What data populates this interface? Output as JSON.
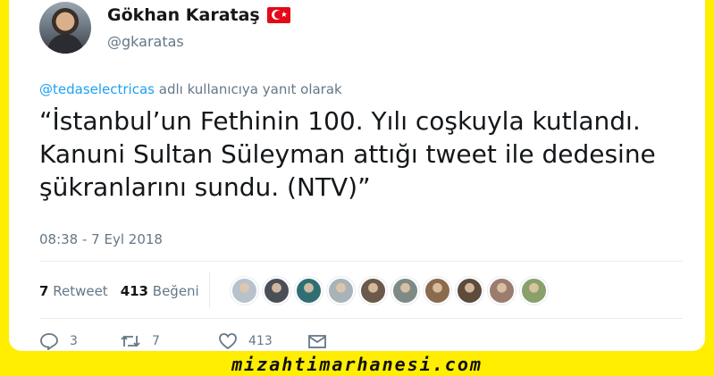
{
  "user": {
    "display_name": "Gökhan Karataş",
    "handle": "@gkaratas",
    "flag_icon": "turkey-flag-icon"
  },
  "reply": {
    "mention": "@tedaselectricas",
    "suffix": " adlı kullanıcıya yanıt olarak"
  },
  "tweet": {
    "text": "“İstanbul’un Fethinin 100. Yılı coşkuyla kutlandı. Kanuni Sultan Süleyman attığı tweet ile dedesine şükranlarını sundu. (NTV)”",
    "timestamp": "08:38 - 7 Eyl 2018"
  },
  "stats": {
    "retweet_count": "7",
    "retweet_label": "Retweet",
    "like_count": "413",
    "like_label": "Beğeni"
  },
  "likers": [
    {
      "color": "#b7c2cc"
    },
    {
      "color": "#4a4f57"
    },
    {
      "color": "#2f6f73"
    },
    {
      "color": "#a8b3b8"
    },
    {
      "color": "#6b5a4a"
    },
    {
      "color": "#7f8a86"
    },
    {
      "color": "#8b6b4d"
    },
    {
      "color": "#5d4b3c"
    },
    {
      "color": "#9a7d6f"
    },
    {
      "color": "#8aa06a"
    }
  ],
  "actions": {
    "reply_count": "3",
    "retweet_count": "7",
    "like_count": "413"
  },
  "watermark": "mizahtimarhanesi.com"
}
